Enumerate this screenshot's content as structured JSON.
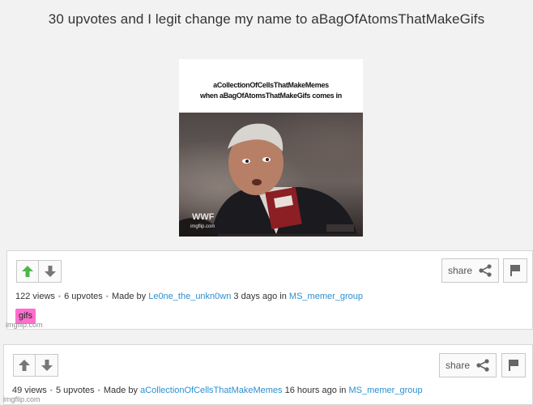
{
  "post": {
    "title": "30 upvotes and I legit change my name to aBagOfAtomsThatMakeGifs"
  },
  "meme": {
    "caption_line1": "aCollectionOfCellsThatMakeMemes",
    "caption_line2": "when aBagOfAtomsThatMakeGifs comes in",
    "watermark": "imgflip.com"
  },
  "cards": [
    {
      "share_label": "share",
      "views": "122 views",
      "upvotes": "6 upvotes",
      "made_by_prefix": "Made by",
      "author": "Le0ne_the_unkn0wn",
      "time": "3 days ago in",
      "stream": "MS_memer_group",
      "tag": "gifs",
      "upvote_active": true
    },
    {
      "share_label": "share",
      "views": "49 views",
      "upvotes": "5 upvotes",
      "made_by_prefix": "Made by",
      "author": "aCollectionOfCellsThatMakeMemes",
      "time": "16 hours ago in",
      "stream": "MS_memer_group",
      "upvote_active": false
    }
  ],
  "footer": {
    "watermark": "imgflip.com"
  },
  "colors": {
    "upvote_active": "#4cb648",
    "vote_inactive": "#777777",
    "link": "#2b8fcf",
    "tag_bg": "#ff6ecf"
  }
}
